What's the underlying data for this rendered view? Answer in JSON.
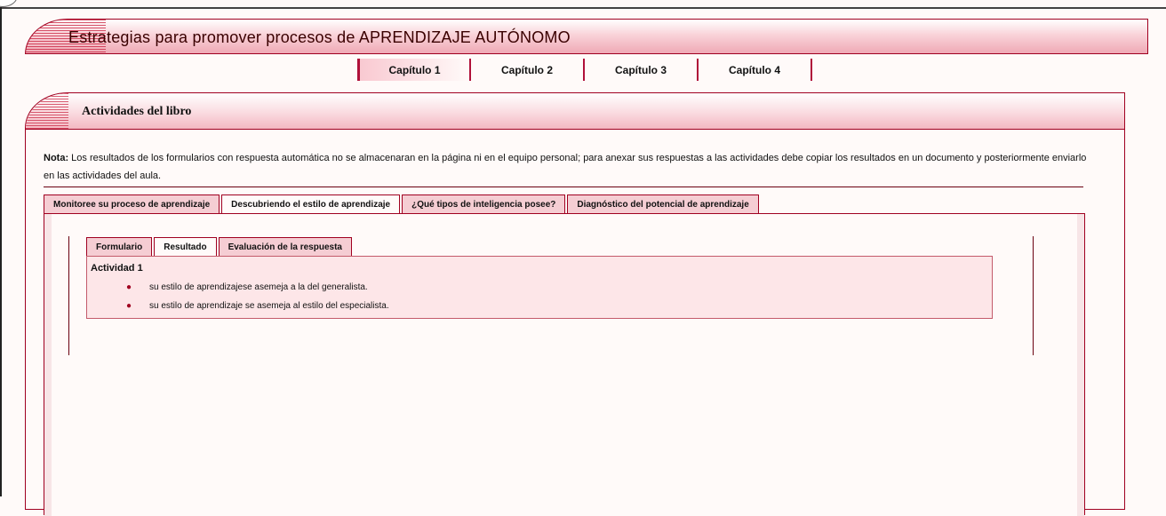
{
  "header": {
    "title": "Estrategias para promover procesos de  APRENDIZAJE AUTÓNOMO"
  },
  "chapters": [
    {
      "label": "Capítulo 1",
      "active": true
    },
    {
      "label": "Capítulo 2",
      "active": false
    },
    {
      "label": "Capítulo 3",
      "active": false
    },
    {
      "label": "Capítulo 4",
      "active": false
    }
  ],
  "panel": {
    "title": "Actividades del libro",
    "note_label": "Nota:",
    "note_text": " Los resultados de los formularios con respuesta automática no se almacenaran en la página ni en el equipo personal; para anexar sus respuestas a las actividades debe copiar los resultados en un documento y posteriormente enviarlo en las actividades del aula."
  },
  "outer_tabs": [
    {
      "label": "Monitoree su proceso de aprendizaje",
      "active": false
    },
    {
      "label": "Descubriendo el estilo de aprendizaje",
      "active": true
    },
    {
      "label": "¿Qué tipos de inteligencia posee?",
      "active": false
    },
    {
      "label": "Diagnóstico del potencial de aprendizaje",
      "active": false
    }
  ],
  "inner_tabs": [
    {
      "label": "Formulario",
      "active": false
    },
    {
      "label": "Resultado",
      "active": true
    },
    {
      "label": "Evaluación de la respuesta",
      "active": false
    }
  ],
  "result": {
    "activity_title": "Actividad 1",
    "items": [
      "su estilo de aprendizajese asemeja a la del generalista.",
      "su estilo de aprendizaje se asemeja al estilo del especialista."
    ],
    "bullet": "●"
  },
  "colors": {
    "accent": "#a00020",
    "tab_bg": "#f5cdd3",
    "content_bg": "#fde6e8",
    "page_bg": "#fffaf9"
  }
}
